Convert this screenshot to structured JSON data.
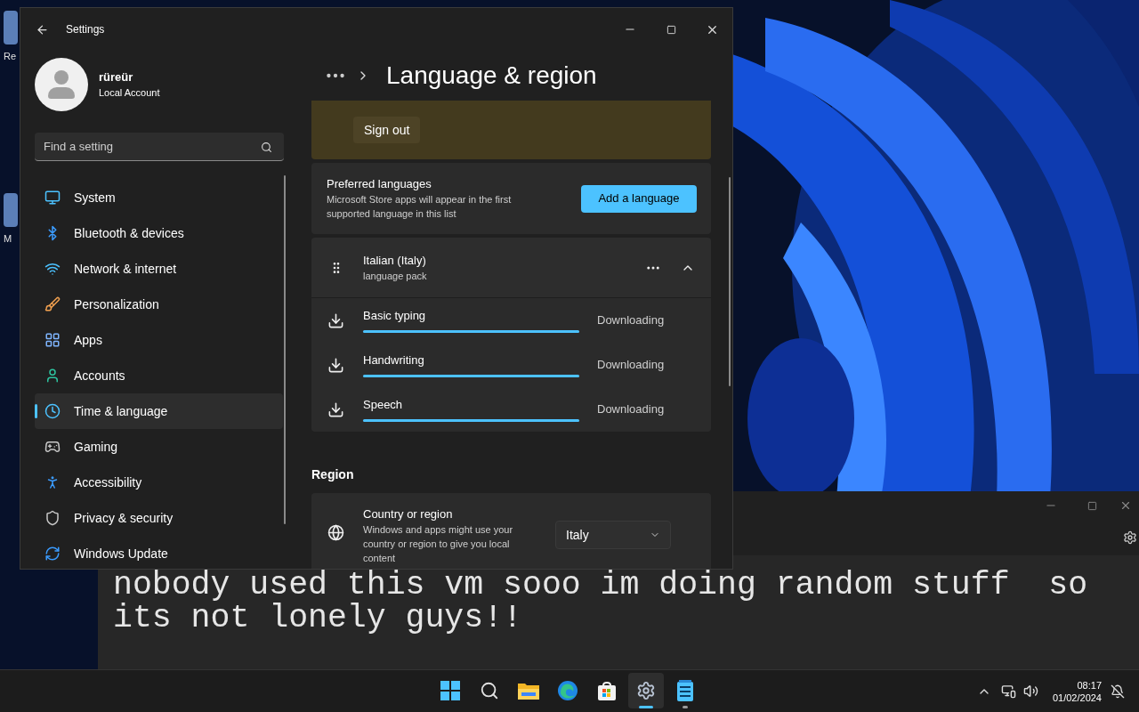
{
  "desktop_icons": [
    {
      "label": "Re"
    },
    {
      "label": "M"
    }
  ],
  "settings_window": {
    "title": "Settings",
    "account": {
      "name": "rüreür",
      "type": "Local Account"
    },
    "search": {
      "placeholder": "Find a setting"
    },
    "nav": [
      {
        "kind": "system",
        "label": "System",
        "selected": false
      },
      {
        "kind": "bluetooth",
        "label": "Bluetooth & devices",
        "selected": false
      },
      {
        "kind": "network",
        "label": "Network & internet",
        "selected": false
      },
      {
        "kind": "personalization",
        "label": "Personalization",
        "selected": false
      },
      {
        "kind": "apps",
        "label": "Apps",
        "selected": false
      },
      {
        "kind": "accounts",
        "label": "Accounts",
        "selected": false
      },
      {
        "kind": "time",
        "label": "Time & language",
        "selected": true
      },
      {
        "kind": "gaming",
        "label": "Gaming",
        "selected": false
      },
      {
        "kind": "accessibility",
        "label": "Accessibility",
        "selected": false
      },
      {
        "kind": "privacy",
        "label": "Privacy & security",
        "selected": false
      },
      {
        "kind": "update",
        "label": "Windows Update",
        "selected": false
      }
    ],
    "breadcrumb": {
      "title": "Language & region"
    },
    "notice": {
      "button": "Sign out"
    },
    "preferred_languages": {
      "title": "Preferred languages",
      "description": "Microsoft Store apps will appear in the first supported language in this list",
      "button": "Add a language"
    },
    "language": {
      "name": "Italian (Italy)",
      "detail": "language pack",
      "expanded": true,
      "features": [
        {
          "name": "Basic typing",
          "level": 1,
          "status": "Downloading"
        },
        {
          "name": "Handwriting",
          "level": 1,
          "status": "Downloading"
        },
        {
          "name": "Speech",
          "level": 1,
          "status": "Downloading"
        }
      ]
    },
    "region": {
      "heading": "Region",
      "title": "Country or region",
      "description": "Windows and apps might use your country or region to give you local content",
      "value": "Italy"
    }
  },
  "notepad": {
    "lines": [
      "nobody used this vm sooo im doing random stuff  so",
      "its not lonely guys!!"
    ]
  },
  "taskbar": {
    "apps": [
      {
        "kind": "start",
        "selected": false,
        "running": false
      },
      {
        "kind": "search",
        "selected": false,
        "running": false
      },
      {
        "kind": "explorer",
        "selected": false,
        "running": false
      },
      {
        "kind": "edge",
        "selected": false,
        "running": false
      },
      {
        "kind": "store",
        "selected": false,
        "running": false
      },
      {
        "kind": "settings",
        "selected": true,
        "running": true
      },
      {
        "kind": "notepad",
        "selected": false,
        "running": true
      }
    ],
    "time": "08:17",
    "date": "01/02/2024"
  }
}
